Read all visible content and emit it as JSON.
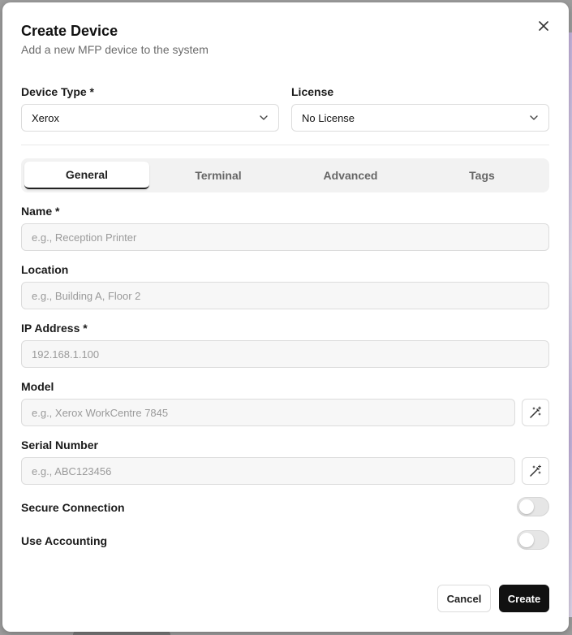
{
  "dialog": {
    "title": "Create Device",
    "subtitle": "Add a new MFP device to the system"
  },
  "device_type": {
    "label": "Device Type *",
    "value": "Xerox"
  },
  "license": {
    "label": "License",
    "value": "No License"
  },
  "tabs": [
    {
      "label": "General",
      "active": true
    },
    {
      "label": "Terminal",
      "active": false
    },
    {
      "label": "Advanced",
      "active": false
    },
    {
      "label": "Tags",
      "active": false
    }
  ],
  "fields": {
    "name": {
      "label": "Name *",
      "placeholder": "e.g., Reception Printer",
      "value": ""
    },
    "location": {
      "label": "Location",
      "placeholder": "e.g., Building A, Floor 2",
      "value": ""
    },
    "ip": {
      "label": "IP Address *",
      "placeholder": "192.168.1.100",
      "value": ""
    },
    "model": {
      "label": "Model",
      "placeholder": "e.g., Xerox WorkCentre 7845",
      "value": ""
    },
    "serial": {
      "label": "Serial Number",
      "placeholder": "e.g., ABC123456",
      "value": ""
    }
  },
  "toggles": {
    "secure": {
      "label": "Secure Connection",
      "on": false
    },
    "accounting": {
      "label": "Use Accounting",
      "on": false
    }
  },
  "buttons": {
    "cancel": "Cancel",
    "create": "Create"
  },
  "icons": {
    "close": "close-icon",
    "chevron": "chevron-down-icon",
    "wand": "magic-wand-icon"
  },
  "colors": {
    "primary": "#111111",
    "tab_bg": "#f2f2f2",
    "input_bg": "#f7f7f7"
  }
}
